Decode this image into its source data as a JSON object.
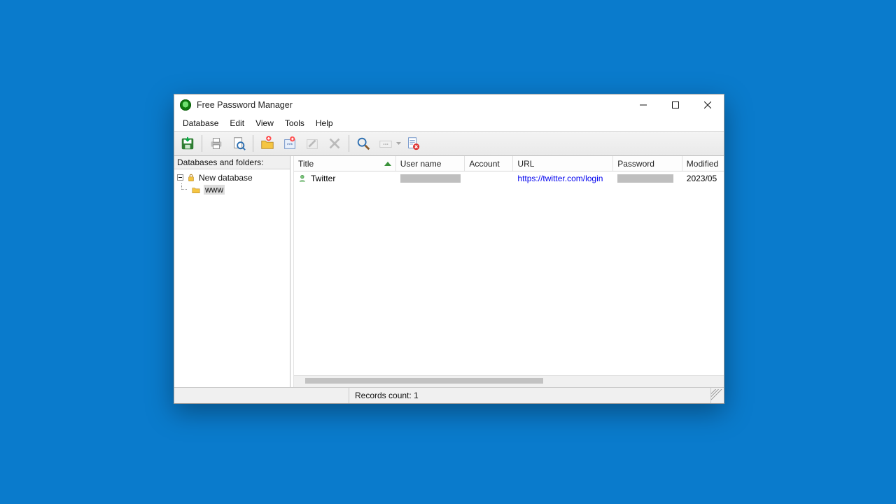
{
  "window": {
    "title": "Free Password Manager"
  },
  "menu": {
    "database": "Database",
    "edit": "Edit",
    "view": "View",
    "tools": "Tools",
    "help": "Help"
  },
  "sidebar": {
    "header": "Databases and folders:",
    "root": "New database",
    "folder": "www"
  },
  "columns": {
    "title": "Title",
    "user": "User name",
    "account": "Account",
    "url": "URL",
    "password": "Password",
    "modified": "Modified"
  },
  "entries": [
    {
      "title": "Twitter",
      "url": "https://twitter.com/login",
      "modified": "2023/05"
    }
  ],
  "status": {
    "records": "Records count: 1"
  }
}
